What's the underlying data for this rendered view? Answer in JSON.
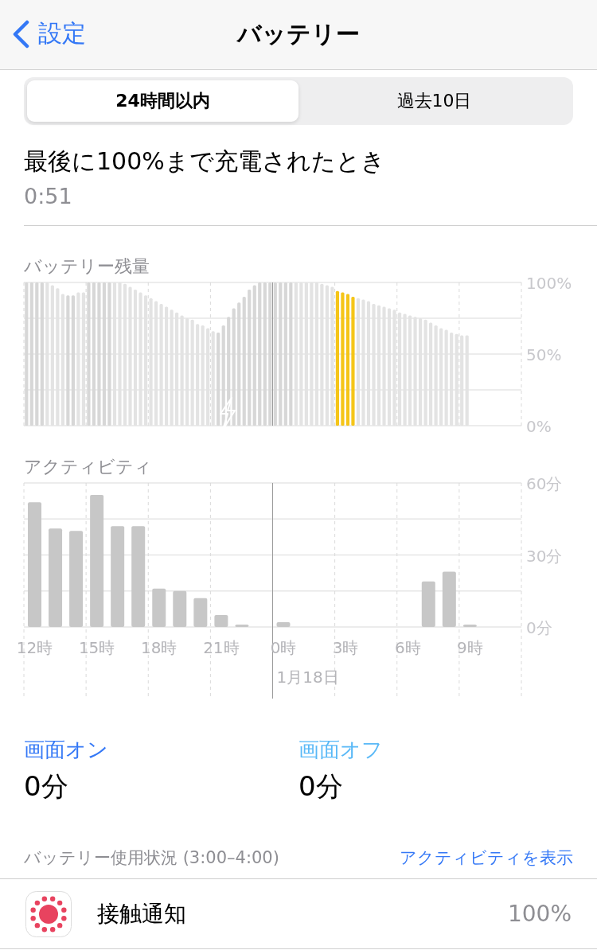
{
  "nav": {
    "back_label": "設定",
    "title": "バッテリー"
  },
  "tabs": [
    {
      "label": "24時間以内",
      "selected": true
    },
    {
      "label": "過去10日",
      "selected": false
    }
  ],
  "last_charge": {
    "label": "最後に100%まで充電されたとき",
    "time": "0:51"
  },
  "battery_chart": {
    "title": "バッテリー残量",
    "axis_labels": [
      "100%",
      "50%",
      "0%"
    ],
    "charging_icon": true
  },
  "activity_chart": {
    "chart_data": {
      "type": "bar",
      "title": "アクティビティ",
      "categories": [
        "12時",
        null,
        null,
        "15時",
        null,
        null,
        "18時",
        null,
        null,
        "21時",
        null,
        null,
        "0時",
        null,
        null,
        "3時",
        null,
        null,
        "6時",
        null,
        null,
        "9時",
        null,
        null
      ],
      "grid": true,
      "ylim": [
        0,
        60
      ],
      "yticks": [
        {
          "value": 0,
          "label": "0分"
        },
        {
          "value": 30,
          "label": "30分"
        },
        {
          "value": 60,
          "label": "60分"
        }
      ],
      "annotations": [
        "1月18日"
      ],
      "series": [
        {
          "color": "#c7c7c7",
          "values": [
            52,
            41,
            40,
            55,
            42,
            42,
            16,
            15,
            12,
            5,
            1,
            0,
            2,
            0,
            0,
            0,
            0,
            0,
            0,
            19,
            23,
            1,
            null,
            null
          ]
        }
      ]
    }
  },
  "screen_time": [
    {
      "kind": "on",
      "label": "画面オン",
      "value": "0分"
    },
    {
      "kind": "off",
      "label": "画面オフ",
      "value": "0分"
    }
  ],
  "usage": {
    "title": "バッテリー使用状況 (3:00–4:00)",
    "link": "アクティビティを表示",
    "apps": [
      {
        "name": "接触通知",
        "percent": "100%"
      }
    ]
  }
}
